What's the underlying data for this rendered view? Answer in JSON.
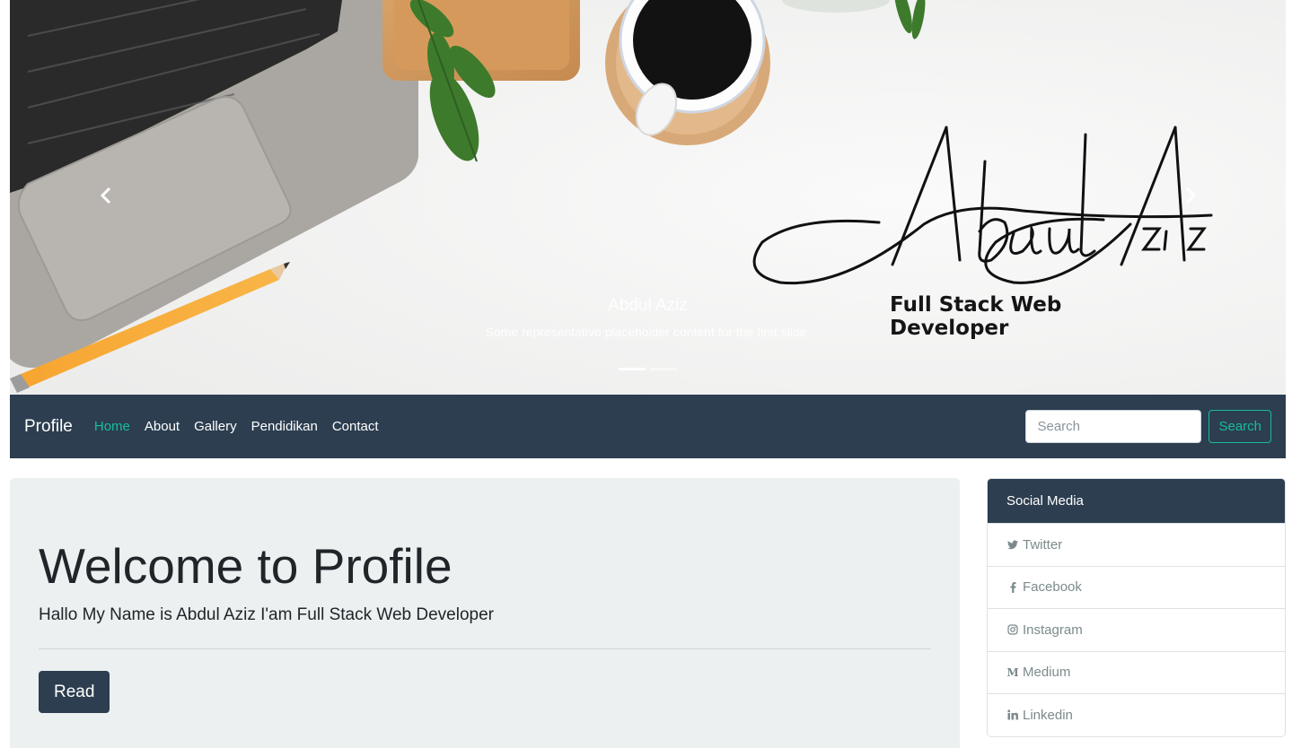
{
  "carousel": {
    "caption_title": "Abdul Aziz",
    "caption_text": "Some representative placeholder content for the first slide.",
    "signature_text": "Abdul Aziz",
    "subtitle": "Full Stack Web Developer",
    "indicators": [
      true,
      false
    ]
  },
  "navbar": {
    "brand": "Profile",
    "links": [
      {
        "label": "Home",
        "active": true
      },
      {
        "label": "About",
        "active": false
      },
      {
        "label": "Gallery",
        "active": false
      },
      {
        "label": "Pendidikan",
        "active": false
      },
      {
        "label": "Contact",
        "active": false
      }
    ],
    "search_placeholder": "Search",
    "search_button": "Search"
  },
  "jumbotron": {
    "title": "Welcome to Profile",
    "lead": "Hallo My Name is Abdul Aziz I'am Full Stack Web Developer",
    "button": "Read"
  },
  "social": {
    "header": "Social Media",
    "items": [
      {
        "label": "Twitter",
        "icon": "twitter-icon"
      },
      {
        "label": "Facebook",
        "icon": "facebook-icon"
      },
      {
        "label": "Instagram",
        "icon": "instagram-icon"
      },
      {
        "label": "Medium",
        "icon": "medium-icon"
      },
      {
        "label": "Linkedin",
        "icon": "linkedin-icon"
      }
    ]
  },
  "colors": {
    "primary": "#2c3e50",
    "accent": "#18bc9c",
    "jumbotron_bg": "#ecf0f1",
    "muted_text": "#7b8a8b"
  }
}
